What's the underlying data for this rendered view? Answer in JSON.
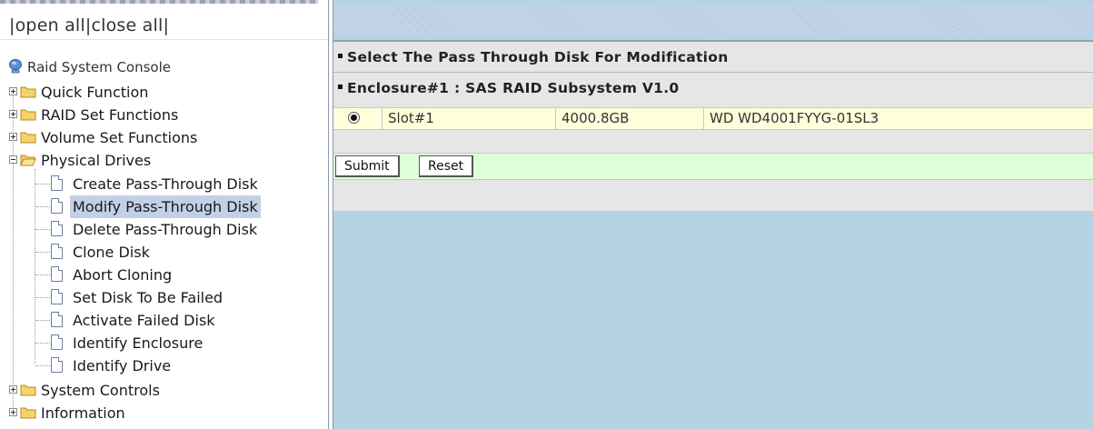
{
  "nav": {
    "open_all": "open all",
    "close_all": "close all",
    "sep": "|",
    "tree": {
      "root": "Raid System Console",
      "items": [
        {
          "label": "Quick Function"
        },
        {
          "label": "RAID Set Functions"
        },
        {
          "label": "Volume Set Functions"
        },
        {
          "label": "Physical Drives",
          "children": [
            {
              "label": "Create Pass-Through Disk"
            },
            {
              "label": "Modify Pass-Through Disk",
              "selected": true
            },
            {
              "label": "Delete Pass-Through Disk"
            },
            {
              "label": "Clone Disk"
            },
            {
              "label": "Abort Cloning"
            },
            {
              "label": "Set Disk To Be Failed"
            },
            {
              "label": "Activate Failed Disk"
            },
            {
              "label": "Identify Enclosure"
            },
            {
              "label": "Identify Drive"
            }
          ]
        },
        {
          "label": "System Controls"
        },
        {
          "label": "Information"
        }
      ]
    }
  },
  "content": {
    "section_title": "Select The Pass Through Disk For Modification",
    "enclosure_title": "Enclosure#1 : SAS RAID Subsystem V1.0",
    "disks": [
      {
        "selected": true,
        "slot": "Slot#1",
        "capacity": "4000.8GB",
        "model": "WD WD4001FYYG-01SL3"
      }
    ],
    "submit_label": "Submit",
    "reset_label": "Reset"
  },
  "colors": {
    "content_bg": "#b4d4e6",
    "selected_row_bg": "#ffffdc",
    "button_row_bg": "#dfffd9",
    "tree_selected_bg": "#c3cfe6"
  }
}
